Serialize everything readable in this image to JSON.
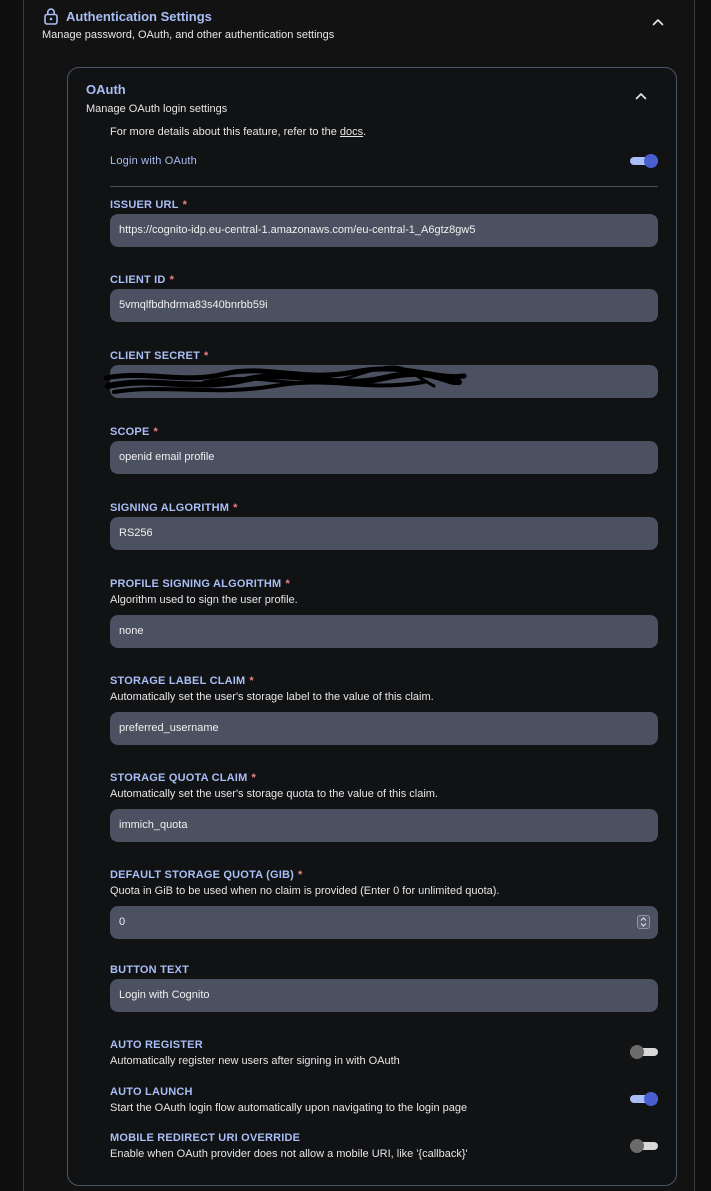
{
  "auth": {
    "title": "Authentication Settings",
    "subtitle": "Manage password, OAuth, and other authentication settings"
  },
  "oauth": {
    "title": "OAuth",
    "subtitle": "Manage OAuth login settings",
    "info_prefix": "For more details about this feature, refer to the ",
    "info_link": "docs",
    "info_suffix": ".",
    "login_with_oauth_label": "Login with OAuth",
    "login_with_oauth_enabled": true
  },
  "fields": {
    "issuer_url": {
      "label": "ISSUER URL",
      "required": "*",
      "value": "https://cognito-idp.eu-central-1.amazonaws.com/eu-central-1_A6gtz8gw5"
    },
    "client_id": {
      "label": "CLIENT ID",
      "required": "*",
      "value": "5vmqlfbdhdrma83s40bnrbb59i"
    },
    "client_secret": {
      "label": "CLIENT SECRET",
      "required": "*",
      "value": ""
    },
    "scope": {
      "label": "SCOPE",
      "required": "*",
      "value": "openid email profile"
    },
    "signing_algorithm": {
      "label": "SIGNING ALGORITHM",
      "required": "*",
      "value": "RS256"
    },
    "profile_signing_algorithm": {
      "label": "PROFILE SIGNING ALGORITHM",
      "required": "*",
      "desc": "Algorithm used to sign the user profile.",
      "value": "none"
    },
    "storage_label_claim": {
      "label": "STORAGE LABEL CLAIM",
      "required": "*",
      "desc": "Automatically set the user's storage label to the value of this claim.",
      "value": "preferred_username"
    },
    "storage_quota_claim": {
      "label": "STORAGE QUOTA CLAIM",
      "required": "*",
      "desc": "Automatically set the user's storage quota to the value of this claim.",
      "value": "immich_quota"
    },
    "default_storage_quota": {
      "label": "DEFAULT STORAGE QUOTA (GIB)",
      "required": "*",
      "desc": "Quota in GiB to be used when no claim is provided (Enter 0 for unlimited quota).",
      "value": "0"
    },
    "button_text": {
      "label": "BUTTON TEXT",
      "value": "Login with Cognito"
    }
  },
  "toggles": {
    "auto_register": {
      "label": "AUTO REGISTER",
      "desc": "Automatically register new users after signing in with OAuth",
      "enabled": false
    },
    "auto_launch": {
      "label": "AUTO LAUNCH",
      "desc": "Start the OAuth login flow automatically upon navigating to the login page",
      "enabled": true
    },
    "mobile_redirect": {
      "label": "MOBILE REDIRECT URI OVERRIDE",
      "desc": "Enable when OAuth provider does not allow a mobile URI, like '{callback}'",
      "enabled": false
    }
  },
  "colors": {
    "accent": "#a8bef5",
    "toggle_on": "#4a5fcf",
    "required": "#f2808a",
    "input_bg": "#4b5160"
  },
  "icons": {
    "lock": "lock-icon",
    "collapse": "chevron-up-icon"
  }
}
